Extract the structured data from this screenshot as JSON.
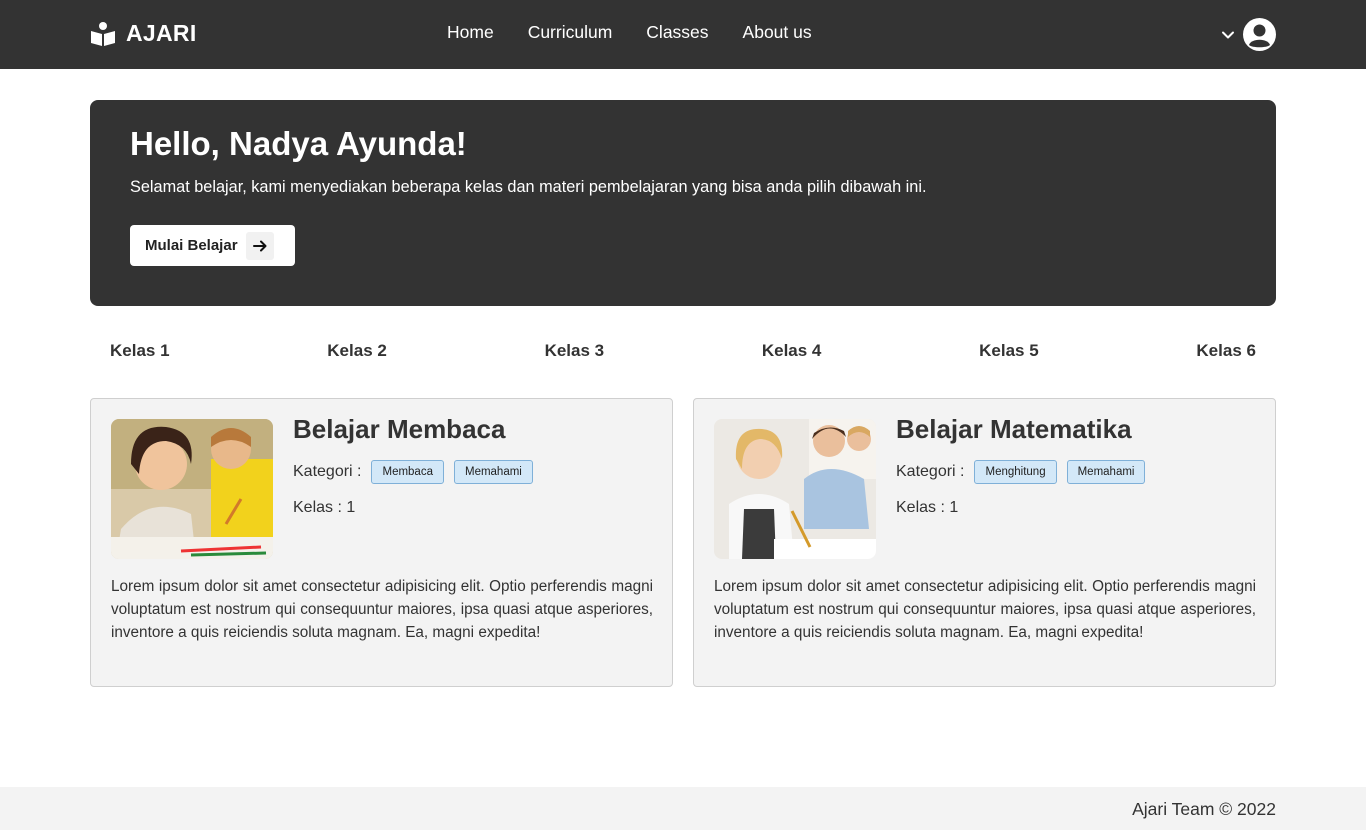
{
  "navbar": {
    "brand": "AJARI",
    "links": [
      "Home",
      "Curriculum",
      "Classes",
      "About us"
    ]
  },
  "hero": {
    "title": "Hello, Nadya Ayunda!",
    "subtitle": "Selamat belajar, kami menyediakan beberapa kelas dan materi pembelajaran yang bisa anda pilih dibawah ini.",
    "button_label": "Mulai Belajar"
  },
  "tabs": [
    "Kelas 1",
    "Kelas 2",
    "Kelas 3",
    "Kelas 4",
    "Kelas 5",
    "Kelas 6"
  ],
  "cards": [
    {
      "title": "Belajar Membaca",
      "category_label": "Kategori :",
      "tags": [
        "Membaca",
        "Memahami"
      ],
      "kelas": "Kelas : 1",
      "description": "Lorem ipsum dolor sit amet consectetur adipisicing elit. Optio perferendis magni voluptatum est nostrum qui consequuntur maiores, ipsa quasi atque asperiores, inventore a quis reiciendis soluta magnam. Ea, magni expedita!"
    },
    {
      "title": "Belajar Matematika",
      "category_label": "Kategori :",
      "tags": [
        "Menghitung",
        "Memahami"
      ],
      "kelas": "Kelas : 1",
      "description": "Lorem ipsum dolor sit amet consectetur adipisicing elit. Optio perferendis magni voluptatum est nostrum qui consequuntur maiores, ipsa quasi atque asperiores, inventore a quis reiciendis soluta magnam. Ea, magni expedita!"
    }
  ],
  "footer": {
    "text": "Ajari Team © 2022"
  },
  "colors": {
    "dark": "#333333",
    "tag_bg": "#d3e8f8",
    "tag_border": "#7fb0d8",
    "card_bg": "#f3f3f3"
  },
  "icons": {
    "brand": "reader-book-icon",
    "dropdown": "chevron-down-icon",
    "user": "user-circle-icon",
    "button": "arrow-right-icon"
  }
}
